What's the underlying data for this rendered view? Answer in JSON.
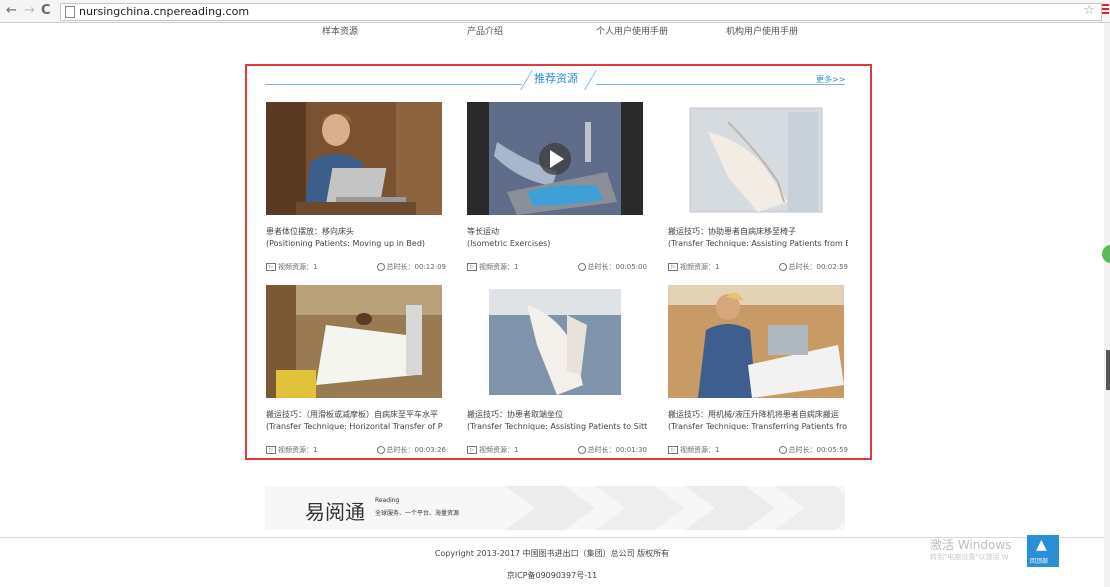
{
  "browser": {
    "url": "nursingchina.cnpereading.com"
  },
  "topnav": [
    "样本资源",
    "产品介绍",
    "个人用户使用手册",
    "机构用户使用手册"
  ],
  "panel": {
    "title": "推荐资源",
    "more": "更多>>"
  },
  "cards": [
    {
      "title_cn": "患者体位摆放：移向床头",
      "title_en": "(Positioning Patients: Moving up in Bed)",
      "type": "视频资源：1",
      "duration": "总时长：00:12:09"
    },
    {
      "title_cn": "等长运动",
      "title_en": "(Isometric Exercises)",
      "type": "视频资源：1",
      "duration": "总时长：00:05:00"
    },
    {
      "title_cn": "搬运技巧：协助患者自病床移至椅子",
      "title_en": "(Transfer Technique: Assisting Patients from Bed",
      "type": "视频资源：1",
      "duration": "总时长：00:02:59"
    },
    {
      "title_cn": "搬运技巧：（用滑板或减摩板）自病床至平车水平",
      "title_en": "(Transfer Technique: Horizontal Transfer of P",
      "type": "视频资源：1",
      "duration": "总时长：00:03:26"
    },
    {
      "title_cn": "搬运技巧：协患者取端坐位",
      "title_en": "(Transfer Technique: Assisting Patients to Sitt",
      "type": "视频资源：1",
      "duration": "总时长：00:01:30"
    },
    {
      "title_cn": "搬运技巧：用机械/液压升降机将患者自病床搬运",
      "title_en": "(Transfer Technique: Transferring Patients fro",
      "type": "视频资源：1",
      "duration": "总时长：00:05:59"
    }
  ],
  "banner": {
    "logo": "易阅通",
    "small1": "Reading",
    "small2": "全球服务、一个平台、海量资源"
  },
  "footer": {
    "copyright": "Copyright 2013-2017 中国图书进出口（集团）总公司 版权所有",
    "icp": "京ICP备09090397号-11"
  },
  "watermark": {
    "line1": "激活 Windows",
    "line2": "转到\"电脑设置\"以激活 W"
  },
  "totop": "回顶部",
  "colors": {
    "accent": "#2b8fd6",
    "panel_border": "#e0393f"
  }
}
